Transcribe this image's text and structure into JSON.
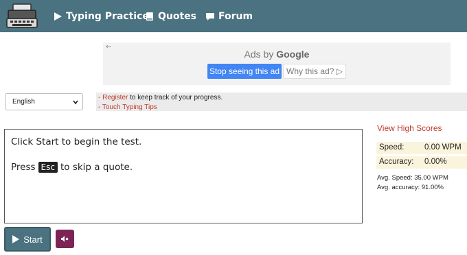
{
  "nav": {
    "logo_icon": "typewriter-icon",
    "items": [
      {
        "label": "Typing Practice",
        "icon": "play-icon"
      },
      {
        "label": "Quotes",
        "icon": "book-icon"
      },
      {
        "label": "Forum",
        "icon": "speech-bubble-icon"
      }
    ],
    "bg_color": "#4a7280"
  },
  "ad": {
    "back_glyph": "←",
    "ads_by": "Ads by",
    "brand": "Google",
    "stop_label": "Stop seeing this ad",
    "why_label": "Why this ad?",
    "why_glyph": "▷"
  },
  "language": {
    "selected": "English"
  },
  "links": {
    "line1_prefix": "- ",
    "register": "Register",
    "line1_suffix": " to keep track of your progress.",
    "line2": "- Touch Typing Tips"
  },
  "typing": {
    "line1_a": "Click ",
    "line1_b": "Start",
    "line1_c": " to begin the test.",
    "line2_a": "Press",
    "line2_key": "Esc",
    "line2_c": "to skip a quote."
  },
  "controls": {
    "start_label": "Start",
    "mute_icon": "speaker-mute-icon"
  },
  "stats": {
    "high_scores": "View High Scores",
    "speed_label": "Speed:",
    "speed_value": "0.00 WPM",
    "accuracy_label": "Accuracy:",
    "accuracy_value": "0.00%",
    "avg_speed": "Avg. Speed: 35.00 WPM",
    "avg_accuracy": "Avg. accuracy: 91.00%"
  }
}
